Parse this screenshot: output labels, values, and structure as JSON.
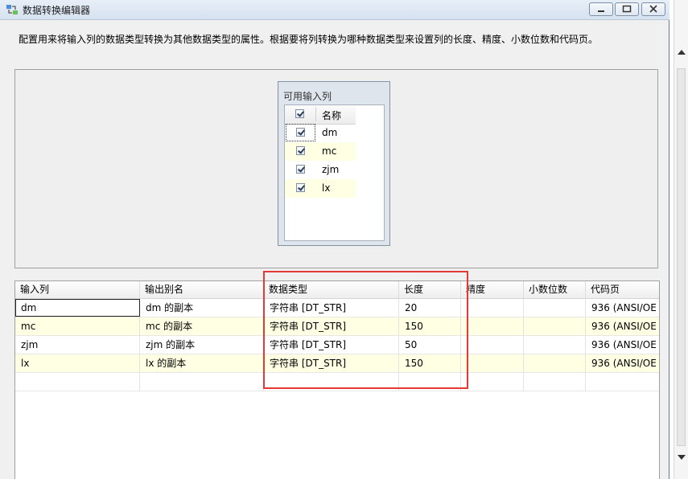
{
  "window": {
    "title": "数据转换编辑器",
    "description": "配置用来将输入列的数据类型转换为其他数据类型的属性。根据要将列转换为哪种数据类型来设置列的长度、精度、小数位数和代码页。",
    "icons": {
      "app": "transform-icon",
      "minimize": "minimize-icon",
      "maximize": "maximize-icon",
      "close": "close-icon"
    }
  },
  "input_panel": {
    "title": "可用输入列",
    "header": "名称",
    "columns": [
      {
        "name": "dm",
        "checked": true
      },
      {
        "name": "mc",
        "checked": true
      },
      {
        "name": "zjm",
        "checked": true
      },
      {
        "name": "lx",
        "checked": true
      }
    ]
  },
  "grid": {
    "headers": [
      "输入列",
      "输出别名",
      "数据类型",
      "长度",
      "精度",
      "小数位数",
      "代码页"
    ],
    "rows": [
      {
        "input": "dm",
        "alias": "dm 的副本",
        "type": "字符串 [DT_STR]",
        "length": "20",
        "precision": "",
        "scale": "",
        "codepage": "936   (ANSI/OE"
      },
      {
        "input": "mc",
        "alias": "mc 的副本",
        "type": "字符串 [DT_STR]",
        "length": "150",
        "precision": "",
        "scale": "",
        "codepage": "936   (ANSI/OE"
      },
      {
        "input": "zjm",
        "alias": "zjm 的副本",
        "type": "字符串 [DT_STR]",
        "length": "50",
        "precision": "",
        "scale": "",
        "codepage": "936   (ANSI/OE"
      },
      {
        "input": "lx",
        "alias": "lx 的副本",
        "type": "字符串 [DT_STR]",
        "length": "150",
        "precision": "",
        "scale": "",
        "codepage": "936   (ANSI/OE"
      }
    ]
  },
  "colors": {
    "highlight": "#e53935",
    "row_alt": "#ffffe3"
  }
}
